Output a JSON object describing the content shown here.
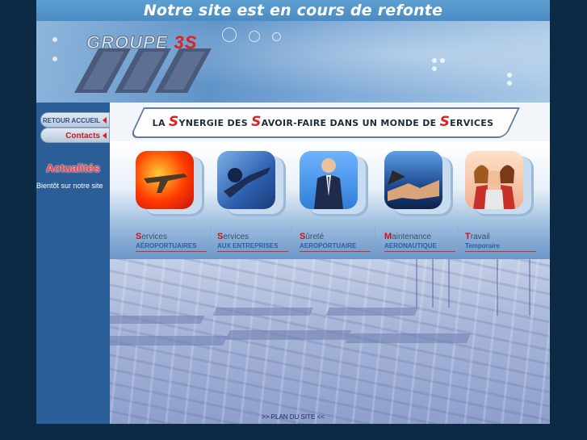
{
  "notice": "Notre site est en cours de refonte",
  "logo": {
    "text": "GROUPE",
    "accent": "3S"
  },
  "sidebar": {
    "home_label": "RETOUR ACCUEIL",
    "contacts_label": "Contacts",
    "news_title": "Actualités",
    "news_text": "Bientôt sur notre site"
  },
  "tagline": {
    "p1": "LA ",
    "b1": "S",
    "p2": "YNERGIE DES ",
    "b2": "S",
    "p3": "AVOIR-FAIRE DANS UN MONDE DE ",
    "b3": "S",
    "p4": "ERVICES"
  },
  "services": [
    {
      "initial": "S",
      "rest": "ervices",
      "sub": "AÉROPORTUAIRES",
      "icon": "airplane-photo"
    },
    {
      "initial": "S",
      "rest": "ervices",
      "sub": "AUX ENTREPRISES",
      "icon": "business-photo"
    },
    {
      "initial": "S",
      "rest": "ûreté",
      "sub": "AEROPORTUAIRE",
      "icon": "security-photo"
    },
    {
      "initial": "M",
      "rest": "aintenance",
      "sub": "AERONAUTIQUE",
      "icon": "handshake-photo"
    },
    {
      "initial": "T",
      "rest": "ravail",
      "sub": "Temporaire",
      "icon": "team-photo"
    }
  ],
  "footer": {
    "sitemap": ">> PLAN DU SITE <<"
  },
  "colors": {
    "page_bg": "#0d2a44",
    "accent": "#e02020",
    "sidebar": "#2b5e96",
    "link_blue": "#2a5fa6"
  }
}
